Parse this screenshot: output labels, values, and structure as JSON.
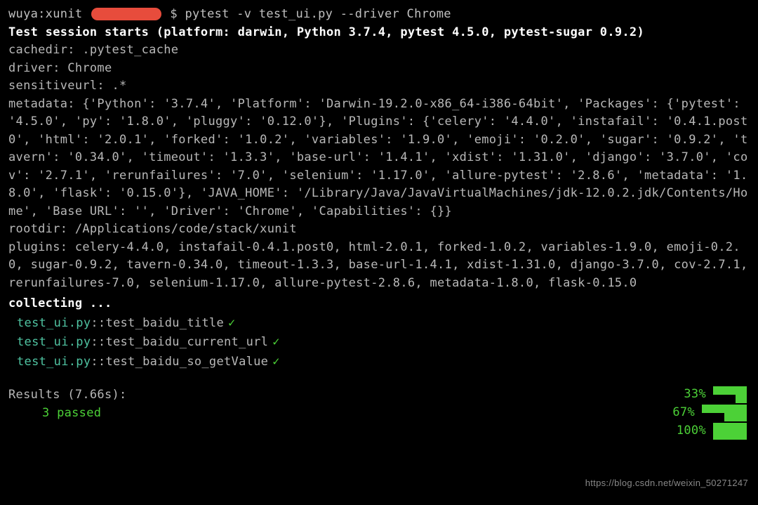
{
  "prompt": {
    "user_host": "wuya:xunit ",
    "command": " pytest -v test_ui.py  --driver Chrome"
  },
  "session_header": "Test session starts (platform: darwin, Python 3.7.4, pytest 4.5.0, pytest-sugar 0.9.2)",
  "cachedir": "cachedir: .pytest_cache",
  "driver": "driver: Chrome",
  "sensitiveurl": "sensitiveurl: .*",
  "metadata": "metadata: {'Python': '3.7.4', 'Platform': 'Darwin-19.2.0-x86_64-i386-64bit', 'Packages': {'pytest': '4.5.0', 'py': '1.8.0', 'pluggy': '0.12.0'}, 'Plugins': {'celery': '4.4.0', 'instafail': '0.4.1.post0', 'html': '2.0.1', 'forked': '1.0.2', 'variables': '1.9.0', 'emoji': '0.2.0', 'sugar': '0.9.2', 'tavern': '0.34.0', 'timeout': '1.3.3', 'base-url': '1.4.1', 'xdist': '1.31.0', 'django': '3.7.0', 'cov': '2.7.1', 'rerunfailures': '7.0', 'selenium': '1.17.0', 'allure-pytest': '2.8.6', 'metadata': '1.8.0', 'flask': '0.15.0'}, 'JAVA_HOME': '/Library/Java/JavaVirtualMachines/jdk-12.0.2.jdk/Contents/Home', 'Base URL': '', 'Driver': 'Chrome', 'Capabilities': {}}",
  "rootdir": "rootdir: /Applications/code/stack/xunit",
  "plugins": "plugins: celery-4.4.0, instafail-0.4.1.post0, html-2.0.1, forked-1.0.2, variables-1.9.0, emoji-0.2.0, sugar-0.9.2, tavern-0.34.0, timeout-1.3.3, base-url-1.4.1, xdist-1.31.0, django-3.7.0, cov-2.7.1, rerunfailures-7.0, selenium-1.17.0, allure-pytest-2.8.6, metadata-1.8.0, flask-0.15.0",
  "collecting": "collecting ...",
  "tests": [
    {
      "file": "test_ui.py",
      "sep": "::",
      "name": "test_baidu_title",
      "status": "✓",
      "percent": "33%"
    },
    {
      "file": "test_ui.py",
      "sep": "::",
      "name": "test_baidu_current_url",
      "status": "✓",
      "percent": "67%"
    },
    {
      "file": "test_ui.py",
      "sep": "::",
      "name": "test_baidu_so_getValue",
      "status": "✓",
      "percent": "100%"
    }
  ],
  "results_label": "Results (7.66s):",
  "passed": "3 passed",
  "watermark": "https://blog.csdn.net/weixin_50271247"
}
